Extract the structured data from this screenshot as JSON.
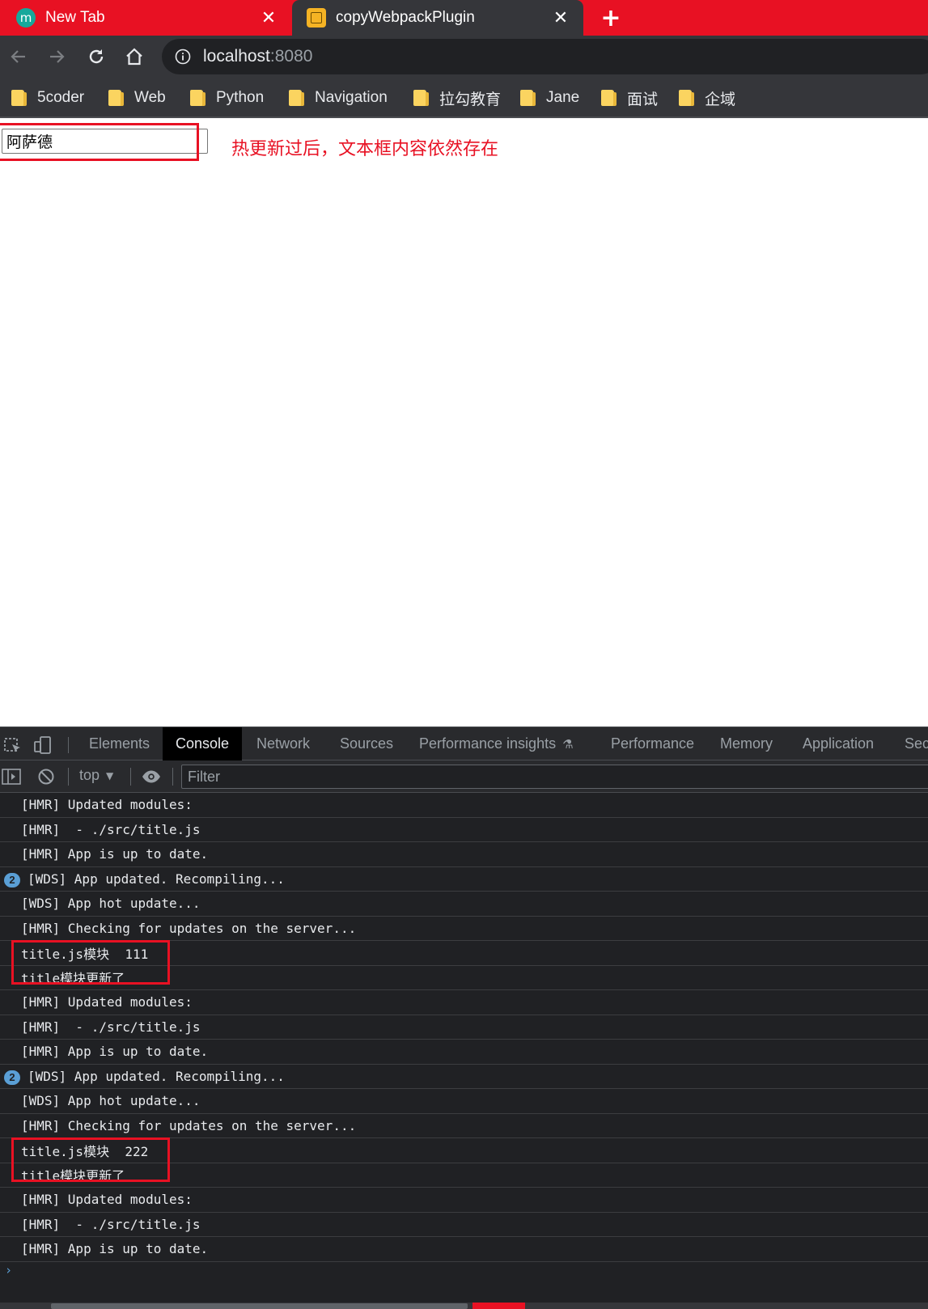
{
  "browser": {
    "tabs": [
      {
        "title": "New Tab",
        "favicon": "m",
        "active": false
      },
      {
        "title": "copyWebpackPlugin",
        "favicon": "lagou-icon",
        "active": true
      }
    ],
    "address": {
      "host": "localhost",
      "port": ":8080"
    },
    "bookmarks": [
      "5coder",
      "Web",
      "Python",
      "Navigation",
      "拉勾教育",
      "Jane",
      "面试",
      "企域"
    ],
    "colors": {
      "accent": "#e81123",
      "toolbar": "#35363a",
      "omnibox": "#202124"
    }
  },
  "page": {
    "input_value": "阿萨德",
    "annotation": "热更新过后，文本框内容依然存在"
  },
  "devtools": {
    "tabs": [
      "Elements",
      "Console",
      "Network",
      "Sources",
      "Performance insights",
      "Performance",
      "Memory",
      "Application",
      "Secu"
    ],
    "active_tab": "Console",
    "context": "top",
    "filter_placeholder": "Filter",
    "logs": [
      {
        "text": "[HMR] Updated modules:",
        "count": null
      },
      {
        "text": "[HMR]  - ./src/title.js",
        "count": null
      },
      {
        "text": "[HMR] App is up to date.",
        "count": null
      },
      {
        "text": "[WDS] App updated. Recompiling...",
        "count": "2"
      },
      {
        "text": "[WDS] App hot update...",
        "count": null
      },
      {
        "text": "[HMR] Checking for updates on the server...",
        "count": null
      },
      {
        "text": "title.js模块  111",
        "count": null
      },
      {
        "text": "title模块更新了",
        "count": null
      },
      {
        "text": "[HMR] Updated modules:",
        "count": null
      },
      {
        "text": "[HMR]  - ./src/title.js",
        "count": null
      },
      {
        "text": "[HMR] App is up to date.",
        "count": null
      },
      {
        "text": "[WDS] App updated. Recompiling...",
        "count": "2"
      },
      {
        "text": "[WDS] App hot update...",
        "count": null
      },
      {
        "text": "[HMR] Checking for updates on the server...",
        "count": null
      },
      {
        "text": "title.js模块  222",
        "count": null
      },
      {
        "text": "title模块更新了",
        "count": null
      },
      {
        "text": "[HMR] Updated modules:",
        "count": null
      },
      {
        "text": "[HMR]  - ./src/title.js",
        "count": null
      },
      {
        "text": "[HMR] App is up to date.",
        "count": null
      }
    ],
    "prompt": "›"
  }
}
